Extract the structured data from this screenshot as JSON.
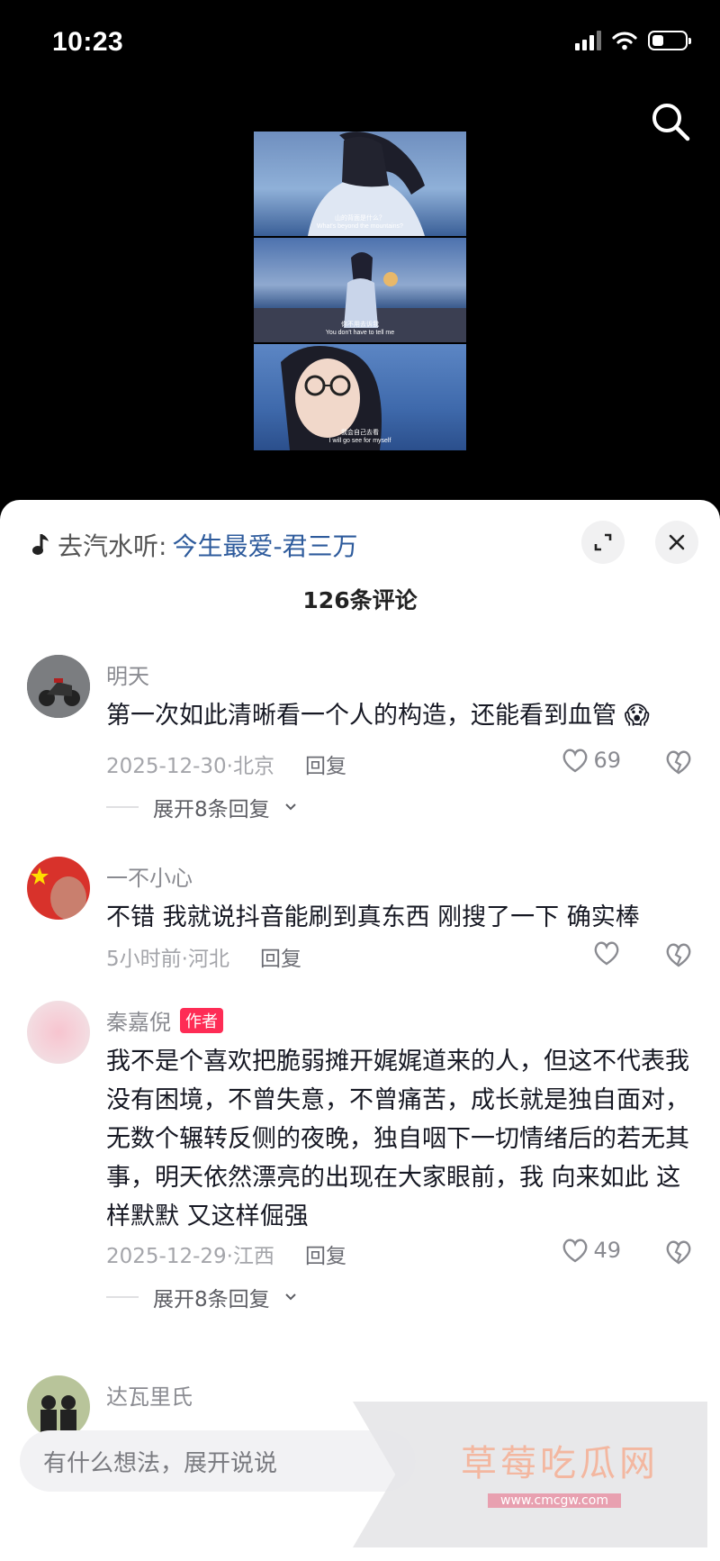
{
  "status": {
    "time": "10:23",
    "battery_level": 0.35
  },
  "video": {
    "subtitles": [
      {
        "cn": "山的背面是什么？",
        "en": "What's beyond the mountains?"
      },
      {
        "cn": "你不用去诉我",
        "en": "You don't have to tell me"
      },
      {
        "cn": "我会自己去看",
        "en": "I will go see for myself"
      }
    ]
  },
  "music": {
    "prefix": "去汽水听:",
    "song": "今生最爱-君三万"
  },
  "comments_title": "126条评论",
  "comments": [
    {
      "user": "明天",
      "text": "第一次如此清晰看一个人的构造，还能看到血管",
      "emoji": "😱",
      "date_location": "2025-12-30·北京",
      "reply": "回复",
      "likes": "69",
      "expand": "展开8条回复"
    },
    {
      "user": "一不小心",
      "text": "不错 我就说抖音能刷到真东西 刚搜了一下 确实棒",
      "date_location": "5小时前·河北",
      "reply": "回复"
    },
    {
      "user": "秦嘉倪",
      "tag": "作者",
      "text": "我不是个喜欢把脆弱摊开娓娓道来的人，但这不代表我没有困境，不曾失意，不曾痛苦，成长就是独自面对，无数个辗转反侧的夜晚，独自咽下一切情绪后的若无其事，明天依然漂亮的出现在大家眼前，我 向来如此 这样默默 又这样倔强",
      "date_location": "2025-12-29·江西",
      "reply": "回复",
      "likes": "49",
      "expand": "展开8条回复"
    },
    {
      "user": "达瓦里氏"
    }
  ],
  "input": {
    "placeholder": "有什么想法，展开说说"
  },
  "watermark": {
    "title": "草莓吃瓜网",
    "url": "www.cmcgw.com"
  },
  "colors": {
    "accent": "#fe2c55",
    "link": "#2e5b9c"
  }
}
